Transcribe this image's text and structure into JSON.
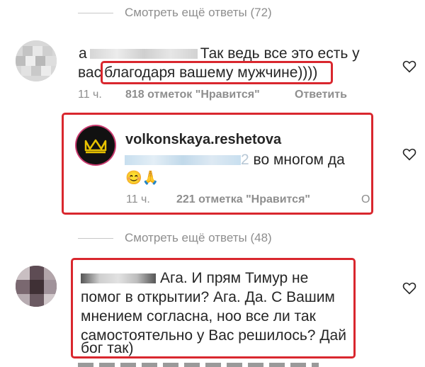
{
  "thread1": {
    "view_more": "Смотреть ещё ответы (72)",
    "comment_prefix": "а",
    "comment_line1": "Так ведь все это есть у",
    "comment_line2_a": "вас",
    "comment_highlight": "благодаря вашему мужчине))))",
    "time": "11 ч.",
    "likes": "818 отметок \"Нравится\"",
    "reply": "Ответить"
  },
  "reply": {
    "username": "volkonskaya.reshetova",
    "mention_end": "2",
    "text": "во многом да",
    "emoji": "😊🙏",
    "time": "11 ч.",
    "likes": "221 отметка \"Нравится\""
  },
  "thread2": {
    "view_more": "Смотреть ещё ответы (48)",
    "line1": "Ага. И прям Тимур не",
    "line2": "помог в открытии? Ага. Да. С Вашим",
    "line3": "мнением согласна, ноо все ли так",
    "line4": "самостоятельно у Вас решилось? Дай",
    "line5": "бог так)"
  },
  "colors": {
    "highlight_border": "#d9272e",
    "avatar_gold": "#e8c200",
    "muted_text": "#8e8e8e"
  }
}
